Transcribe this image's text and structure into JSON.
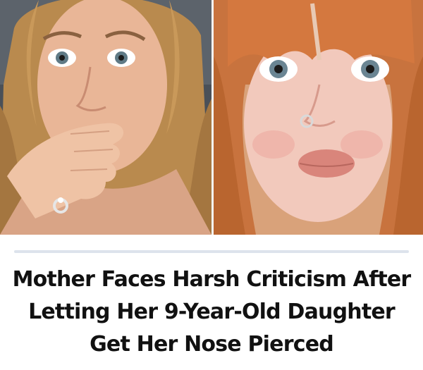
{
  "article": {
    "headline_lines": [
      "Mother Faces Harsh Criticism After",
      "Letting Her 9-Year-Old Daughter",
      "Get Her Nose Pierced"
    ]
  },
  "colors": {
    "separator": "#dde3ec",
    "headline_text": "#111111"
  },
  "images": [
    {
      "name": "woman-hand-over-mouth-photo"
    },
    {
      "name": "girl-nose-ring-photo"
    }
  ]
}
